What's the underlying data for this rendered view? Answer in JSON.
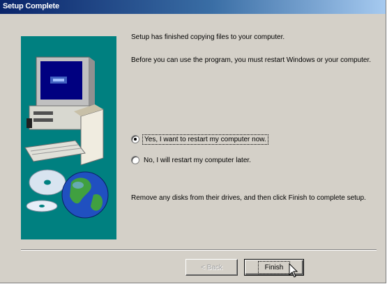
{
  "window": {
    "title": "Setup Complete"
  },
  "messages": {
    "line1": "Setup has finished copying files to your computer.",
    "line2": "Before you can use the program, you must restart Windows or your computer.",
    "line3": "Remove any disks from their drives, and then click Finish to complete setup."
  },
  "options": [
    {
      "label": "Yes, I want to restart my computer now.",
      "selected": true
    },
    {
      "label": "No, I will restart my computer later.",
      "selected": false
    }
  ],
  "buttons": {
    "back": "< Back",
    "finish": "Finish"
  },
  "colors": {
    "dialog_bg": "#d4d0c8",
    "title_start": "#0a246a",
    "title_end": "#a6caf0",
    "art_panel": "#008080"
  },
  "icons": {
    "illustration": "computer-cd-globe-illustration",
    "cursor": "mouse-pointer-icon"
  }
}
